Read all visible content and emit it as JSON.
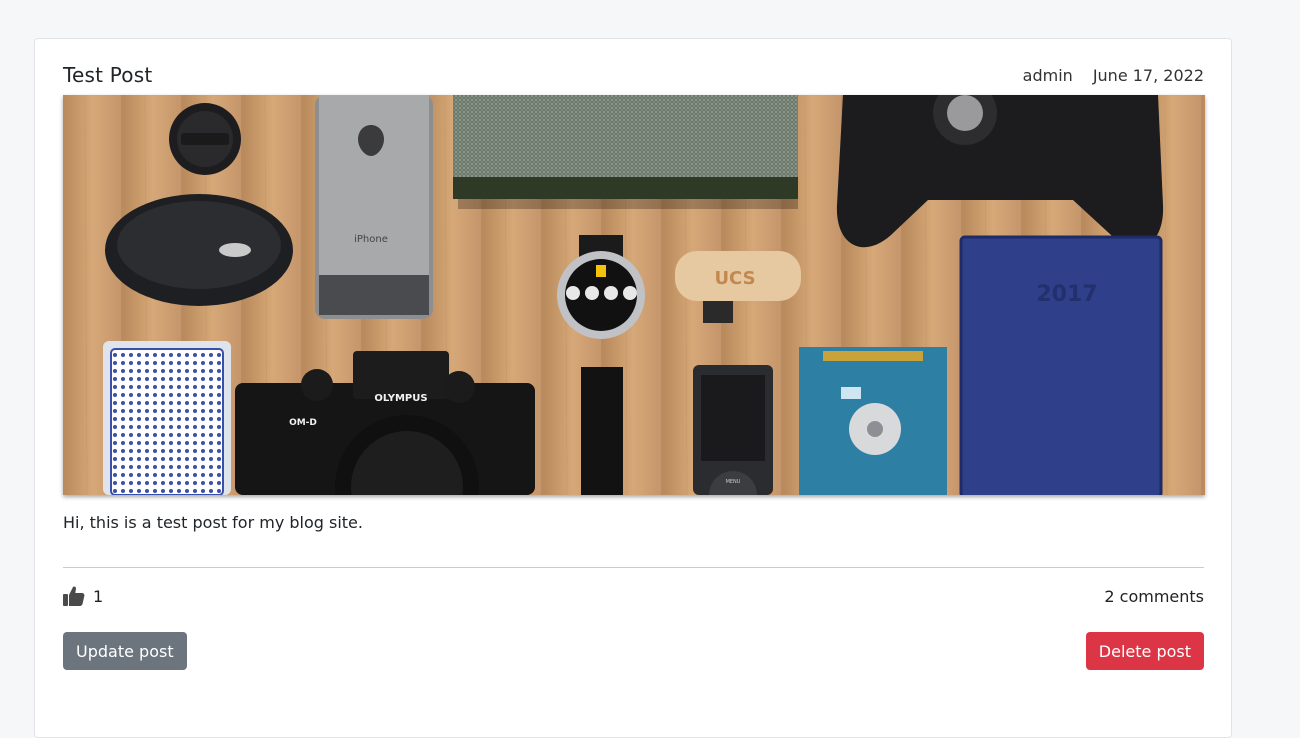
{
  "post": {
    "title": "Test Post",
    "author": "admin",
    "date": "June 17, 2022",
    "body": "Hi, this is a test post for my blog site.",
    "image": {
      "description_icon": "desk-gadgets-photo",
      "iphone_text": "iPhone",
      "camera_brand": "OLYMPUS",
      "camera_model": "OM-D",
      "usb_text": "UCS",
      "notebook_year": "2017",
      "ipod_text": "MENU"
    },
    "likes": "1",
    "comments": "2 comments",
    "update_label": "Update post",
    "delete_label": "Delete post"
  },
  "colors": {
    "secondary": "#6c757d",
    "danger": "#dc3545",
    "background": "#f6f7f9",
    "wood": "#c99a6b"
  },
  "icons": {
    "like": "thumbs-up-icon"
  }
}
